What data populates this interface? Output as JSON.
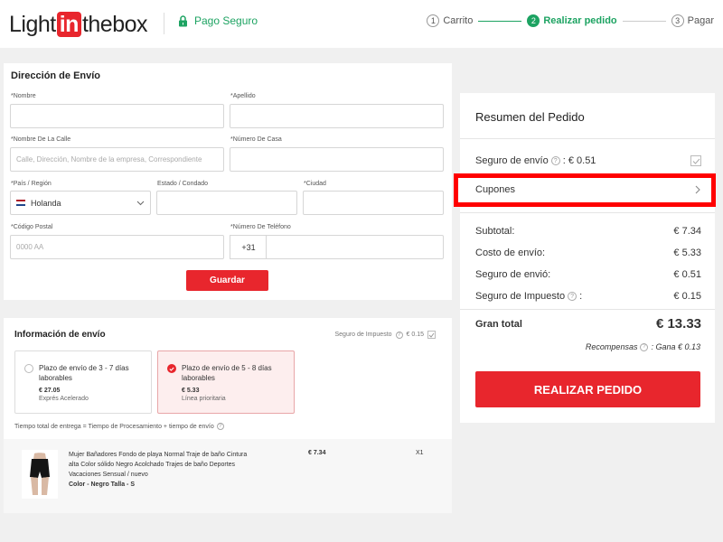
{
  "header": {
    "logo": {
      "prefix": "Light",
      "in": "in",
      "suffix": "thebox"
    },
    "secure_label": "Pago Seguro",
    "steps": [
      {
        "num": "1",
        "label": "Carrito"
      },
      {
        "num": "2",
        "label": "Realizar pedido"
      },
      {
        "num": "3",
        "label": "Pagar"
      }
    ]
  },
  "address": {
    "title": "Dirección de Envío",
    "first_name_label": "*Nombre",
    "last_name_label": "*Apellido",
    "street_label": "*Nombre De La Calle",
    "street_placeholder": "Calle, Dirección, Nombre de la empresa, Correspondiente",
    "house_number_label": "*Número De Casa",
    "country_label": "*País / Región",
    "country_value": "Holanda",
    "state_label": "Estado / Condado",
    "city_label": "*Ciudad",
    "postal_label": "*Código Postal",
    "postal_placeholder": "0000 AA",
    "phone_label": "*Número De Teléfono",
    "phone_prefix": "+31",
    "save_button": "Guardar"
  },
  "shipping": {
    "title": "Información de envío",
    "tax_label": "Seguro de Impuesto",
    "tax_value": "€ 0.15",
    "options": [
      {
        "title": "Plazo de envío de 3 - 7 días laborables",
        "price": "€ 27.05",
        "line": "Exprés Acelerado",
        "selected": false
      },
      {
        "title": "Plazo de envío de 5 - 8 días laborables",
        "price": "€ 5.33",
        "line": "Línea prioritaria",
        "selected": true
      }
    ],
    "note": "Tiempo total de entrega = Tiempo de Procesamiento + tiempo de envío",
    "product": {
      "name": "Mujer Bañadores Fondo de playa Normal Traje de baño Cintura alta Color sólido Negro Acolchado Trajes de baño Deportes Vacaciones Sensual / nuevo",
      "attributes": "Color - Negro  Talla - S",
      "price": "€ 7.34",
      "qty": "X1"
    }
  },
  "summary": {
    "title": "Resumen del Pedido",
    "shipping_insurance_label": "Seguro de envío",
    "shipping_insurance_value": ": € 0.51",
    "coupons_label": "Cupones",
    "subtotal_label": "Subtotal:",
    "subtotal_value": "€ 7.34",
    "shipping_cost_label": "Costo de envío:",
    "shipping_cost_value": "€ 5.33",
    "insurance_label": "Seguro de envió:",
    "insurance_value": "€ 0.51",
    "tax_label": "Seguro de Impuesto",
    "tax_colon": ":",
    "tax_value": "€ 0.15",
    "total_label": "Gran total",
    "total_value": "€ 13.33",
    "rewards_label": "Recompensas",
    "rewards_value": ": Gana € 0.13",
    "order_button": "REALIZAR PEDIDO"
  },
  "colors": {
    "brand_red": "#e8262d",
    "green": "#1da362",
    "highlight": "#ff0000"
  }
}
